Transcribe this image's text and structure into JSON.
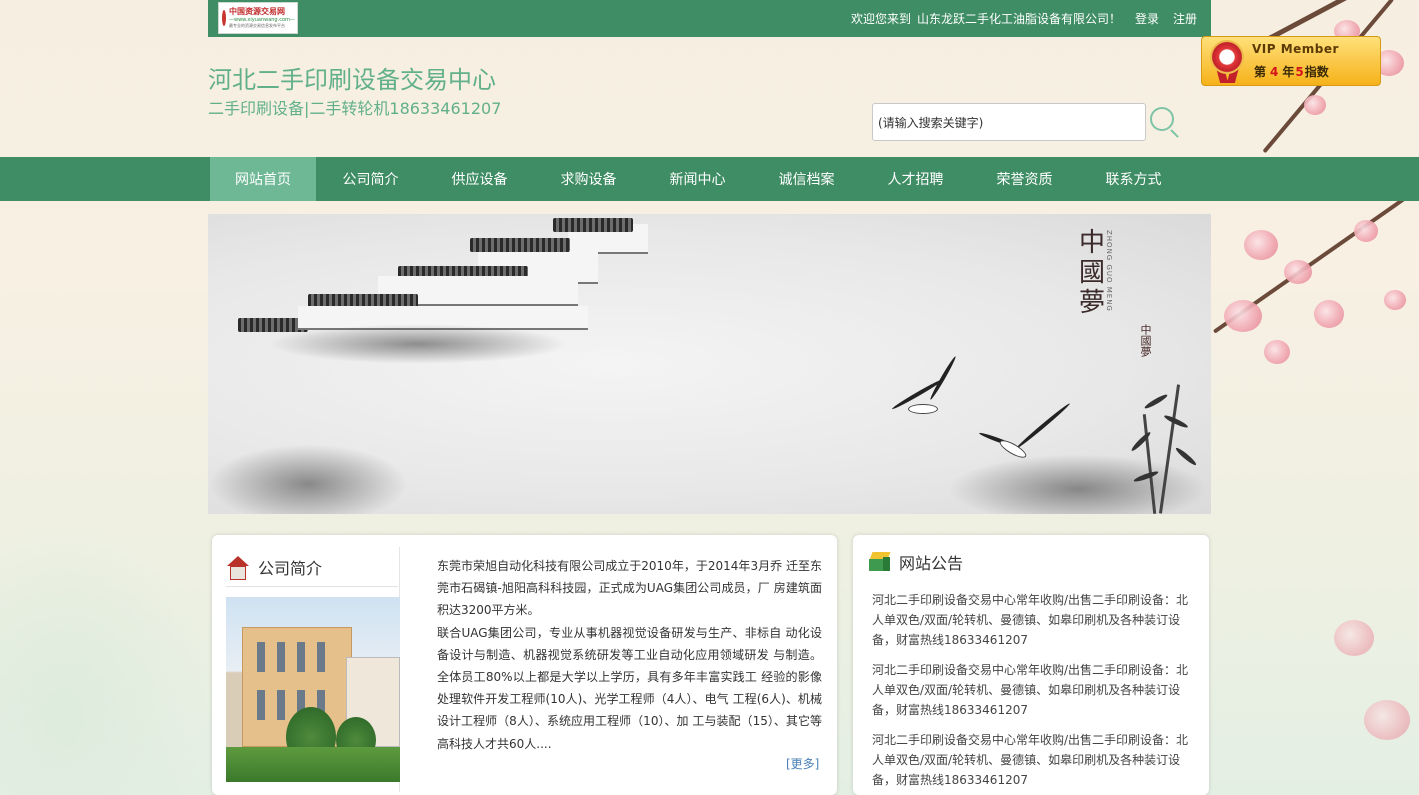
{
  "header": {
    "logo_line1": "中国资源交易网",
    "logo_line2": "—www.xiyuanwang.com—",
    "logo_line3": "最专业的资源交易信息发布平台",
    "welcome_prefix": "欢迎您来到",
    "company_name": "山东龙跃二手化工油脂设备有限公司！",
    "login_label": "登录",
    "register_label": "注册",
    "site_title": "河北二手印刷设备交易中心",
    "site_subtitle": "二手印刷设备|二手转轮机18633461207"
  },
  "vip": {
    "title": "VIP Member",
    "prefix": "第",
    "year_num": "4",
    "year_label": "年",
    "index_num": "5",
    "index_label": "指数"
  },
  "search": {
    "value": "(请输入搜索关键字)",
    "button_icon": "search-icon"
  },
  "nav": {
    "items": [
      {
        "label": "网站首页",
        "active": true
      },
      {
        "label": "公司简介"
      },
      {
        "label": "供应设备"
      },
      {
        "label": "求购设备"
      },
      {
        "label": "新闻中心"
      },
      {
        "label": "诚信档案"
      },
      {
        "label": "人才招聘"
      },
      {
        "label": "荣誉资质"
      },
      {
        "label": "联系方式"
      }
    ]
  },
  "banner": {
    "calligraphy": [
      "中",
      "國",
      "夢"
    ],
    "pinyin": "ZHONG GUO MENG",
    "seal_text": "中國夢"
  },
  "about": {
    "title": "公司简介",
    "icon": "house-icon",
    "paragraphs": [
      "东莞市荣旭自动化科技有限公司成立于2010年，于2014年3月乔 迁至东莞市石碣镇-旭阳高科科技园，正式成为UAG集团公司成员，厂 房建筑面积达3200平方米。",
      "联合UAG集团公司，专业从事机器视觉设备研发与生产、非标自 动化设备设计与制造、机器视觉系统研发等工业自动化应用领域研发 与制造。全体员工80%以上都是大学以上学历，具有多年丰富实践工 经验的影像处理软件开发工程师(10人)、光学工程师（4人）、电气 工程(6人)、机械设计工程师（8人）、系统应用工程师（10）、加 工与装配（15）、其它等高科技人才共60人...."
    ],
    "more_label": "[更多]"
  },
  "notice": {
    "title": "网站公告",
    "icon": "box-icon",
    "items": [
      "河北二手印刷设备交易中心常年收购/出售二手印刷设备：北人单双色/双面/轮转机、曼德镇、如皋印刷机及各种装订设备，财富热线18633461207",
      "河北二手印刷设备交易中心常年收购/出售二手印刷设备：北人单双色/双面/轮转机、曼德镇、如皋印刷机及各种装订设备，财富热线18633461207",
      "河北二手印刷设备交易中心常年收购/出售二手印刷设备：北人单双色/双面/轮转机、曼德镇、如皋印刷机及各种装订设备，财富热线18633461207"
    ]
  },
  "colors": {
    "brand_green": "#3f8d64",
    "nav_active": "#6fb896",
    "title_green": "#62b08a"
  }
}
